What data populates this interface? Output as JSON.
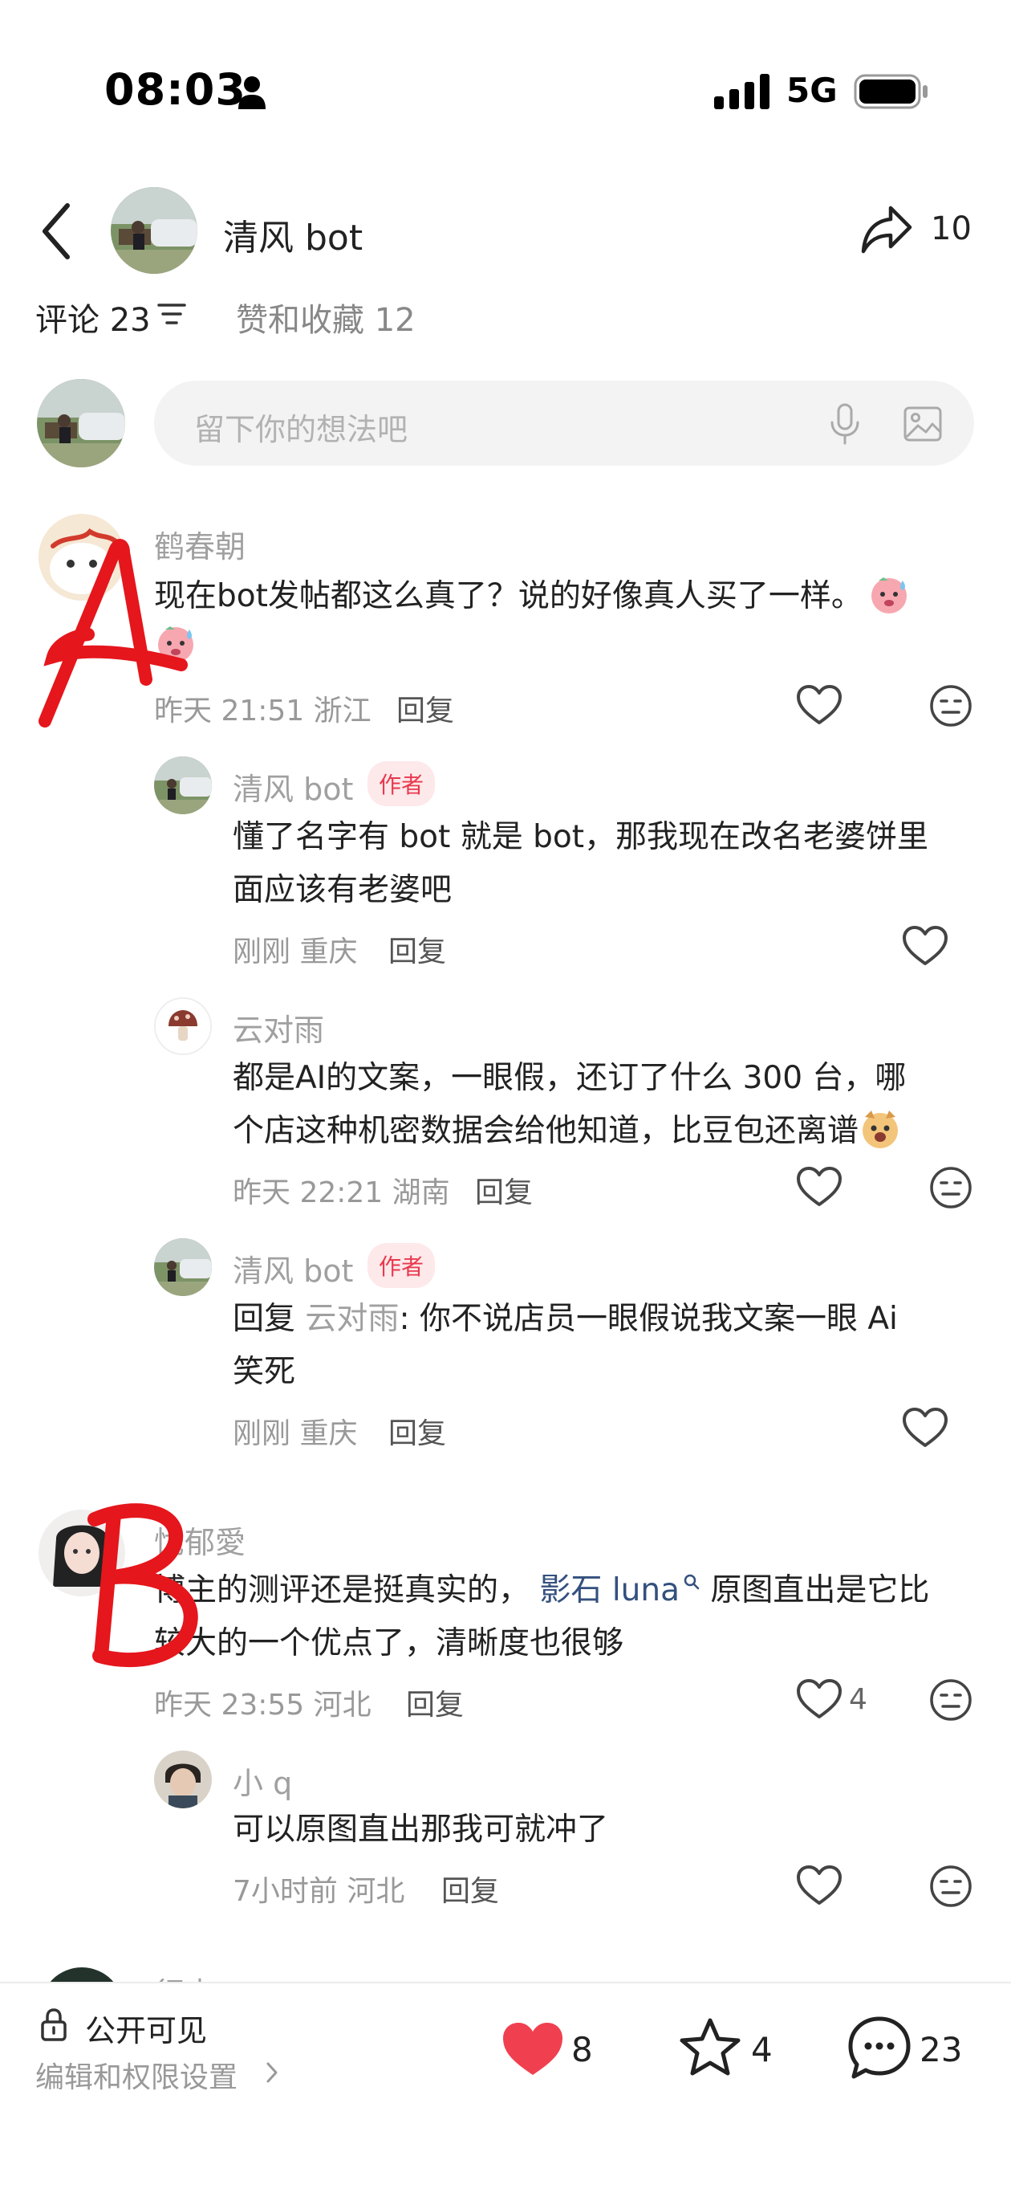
{
  "status_bar": {
    "time": "08:03",
    "network": "5G"
  },
  "header": {
    "name": "清风 bot",
    "share_count": "10"
  },
  "tabs": {
    "comments": "评论 23",
    "likes": "赞和收藏 12"
  },
  "input": {
    "placeholder": "留下你的想法吧"
  },
  "comments": [
    {
      "user": "鹤春朝",
      "text": [
        "现在bot发帖都这么真了？说的好像真人买了一样。"
      ],
      "meta": "昨天 21:51 浙江",
      "reply_label": "回复",
      "replies": [
        {
          "user": "清风 bot",
          "badge": "作者",
          "text": [
            "懂了名字有 bot 就是 bot，那我现在改名老婆饼里",
            "面应该有老婆吧"
          ],
          "meta": "刚刚 重庆",
          "reply_label": "回复"
        },
        {
          "user": "云对雨",
          "text": [
            "都是AI的文案，一眼假，还订了什么 300 台，哪",
            "个店这种机密数据会给他知道，比豆包还离谱"
          ],
          "meta": "昨天 22:21 湖南",
          "reply_label": "回复"
        },
        {
          "user": "清风 bot",
          "badge": "作者",
          "reply_prefix": "回复",
          "reply_to": "云对雨",
          "text": [
            ": 你不说店员一眼假说我文案一眼 Ai",
            "笑死"
          ],
          "meta": "刚刚 重庆",
          "reply_label": "回复"
        }
      ]
    },
    {
      "user": "忧郁愛",
      "text_parts": [
        "博主的测评还是挺真实的，",
        "影石 luna",
        "原图直出是它比"
      ],
      "text_line2": "较大的一个优点了，清晰度也很够",
      "meta": "昨天 23:55 河北",
      "reply_label": "回复",
      "like_count": "4",
      "replies": [
        {
          "user": "小 q",
          "text": [
            "可以原图直出那我可就冲了"
          ],
          "meta": "7小时前 河北",
          "reply_label": "回复"
        }
      ]
    }
  ],
  "annotations": {
    "a": "A",
    "b": "B"
  },
  "next_user_partial": "行来",
  "bottom_bar": {
    "visibility": "公开可见",
    "edit_permissions": "编辑和权限设置",
    "like_count": "8",
    "star_count": "4",
    "comment_count": "23",
    "like_color": "#f0404f"
  }
}
